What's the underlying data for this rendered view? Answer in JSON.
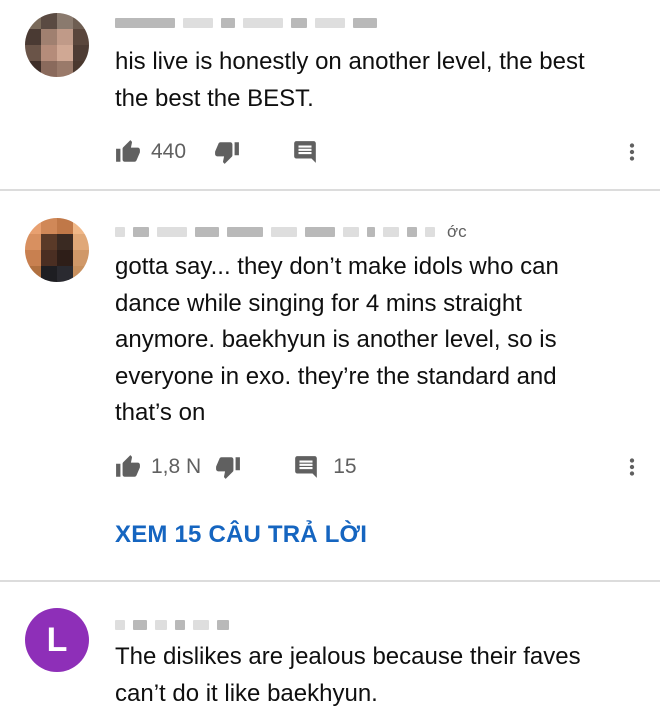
{
  "comments": [
    {
      "author_suffix": "",
      "text_lines": [
        "his live is honestly on another level, the best",
        "the best the BEST."
      ],
      "like_count": "440",
      "reply_count": ""
    },
    {
      "author_suffix": "ớc",
      "text_lines": [
        "gotta say... they don’t make idols who can",
        "dance while singing for 4 mins straight",
        "anymore. baekhyun is another level, so is",
        "everyone in exo. they’re the standard and",
        "that’s on"
      ],
      "like_count": "1,8 N",
      "reply_count": "15",
      "view_replies": "XEM 15 CÂU TRẢ LỜI"
    },
    {
      "author_suffix": "",
      "avatar_letter": "L",
      "avatar_color": "#8e2fb8",
      "text_lines": [
        "The dislikes are jealous because their faves",
        "can’t do it like baekhyun."
      ]
    }
  ],
  "icons": {
    "like": "thumb-up-icon",
    "dislike": "thumb-down-icon",
    "reply": "comment-icon",
    "more": "more-vert-icon"
  },
  "colors": {
    "text": "#0f0f0f",
    "secondary": "#606060",
    "link": "#1565c0",
    "divider": "#dcdcdc"
  }
}
